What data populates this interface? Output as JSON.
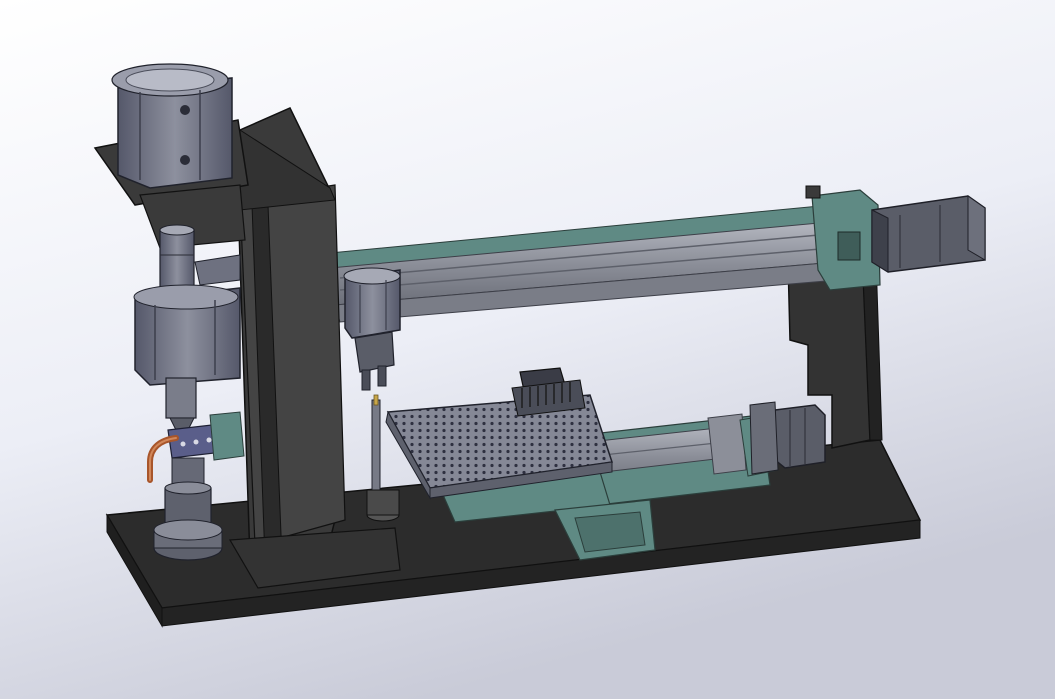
{
  "scene": {
    "kind": "cad-3d-assembly-render",
    "background_gradient": [
      "#ffffff",
      "#eceef6",
      "#c9cbd8"
    ],
    "colors": {
      "base_plate": "#2c2c2c",
      "dark_body": "#3a3a3a",
      "dark_edge": "#1a1a1a",
      "cylinder_metal": "#6f7280",
      "cylinder_light": "#8d909e",
      "rail_grey": "#8c8f99",
      "rail_light": "#b4b7c0",
      "carriage_teal": "#5f8a84",
      "carriage_teal_dark": "#4d716c",
      "tray_top": "#7f8290",
      "tray_side": "#5e616d",
      "motor_body": "#5a5d68",
      "copper_tube": "#a8552a",
      "bracket_purple": "#5a5e8a"
    },
    "components": [
      {
        "name": "base-plate"
      },
      {
        "name": "vertical-column"
      },
      {
        "name": "top-pneumatic-cylinder"
      },
      {
        "name": "vertical-guide-shaft"
      },
      {
        "name": "middle-pneumatic-cylinder"
      },
      {
        "name": "fixture-clamp"
      },
      {
        "name": "copper-tube"
      },
      {
        "name": "round-base-fixture"
      },
      {
        "name": "horizontal-linear-rail"
      },
      {
        "name": "rail-carriage-cylinder"
      },
      {
        "name": "gripper"
      },
      {
        "name": "end-stepper-motor"
      },
      {
        "name": "rear-support-bracket"
      },
      {
        "name": "grid-tray"
      },
      {
        "name": "pin-block"
      },
      {
        "name": "y-axis-rail"
      },
      {
        "name": "y-axis-stepper-motor"
      },
      {
        "name": "teal-carriage-base"
      },
      {
        "name": "probe-pin"
      }
    ]
  }
}
